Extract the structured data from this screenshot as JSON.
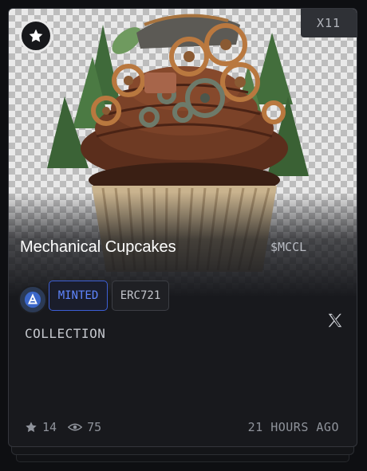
{
  "card": {
    "edition_count": "X11",
    "title": "Mechanical Cupcakes",
    "ticker": "$MCCL",
    "tags": {
      "status": "MINTED",
      "standard": "ERC721"
    },
    "section_label": "COLLECTION",
    "stats": {
      "stars": "14",
      "views": "75"
    },
    "timestamp": "21 HOURS AGO"
  },
  "colors": {
    "background": "#18191d",
    "minted_accent": "#5f86ff",
    "muted_text": "#8f939b"
  },
  "icons": [
    "star-icon",
    "chain-logo-icon",
    "x-logo-icon",
    "star-count-icon",
    "eye-icon"
  ]
}
